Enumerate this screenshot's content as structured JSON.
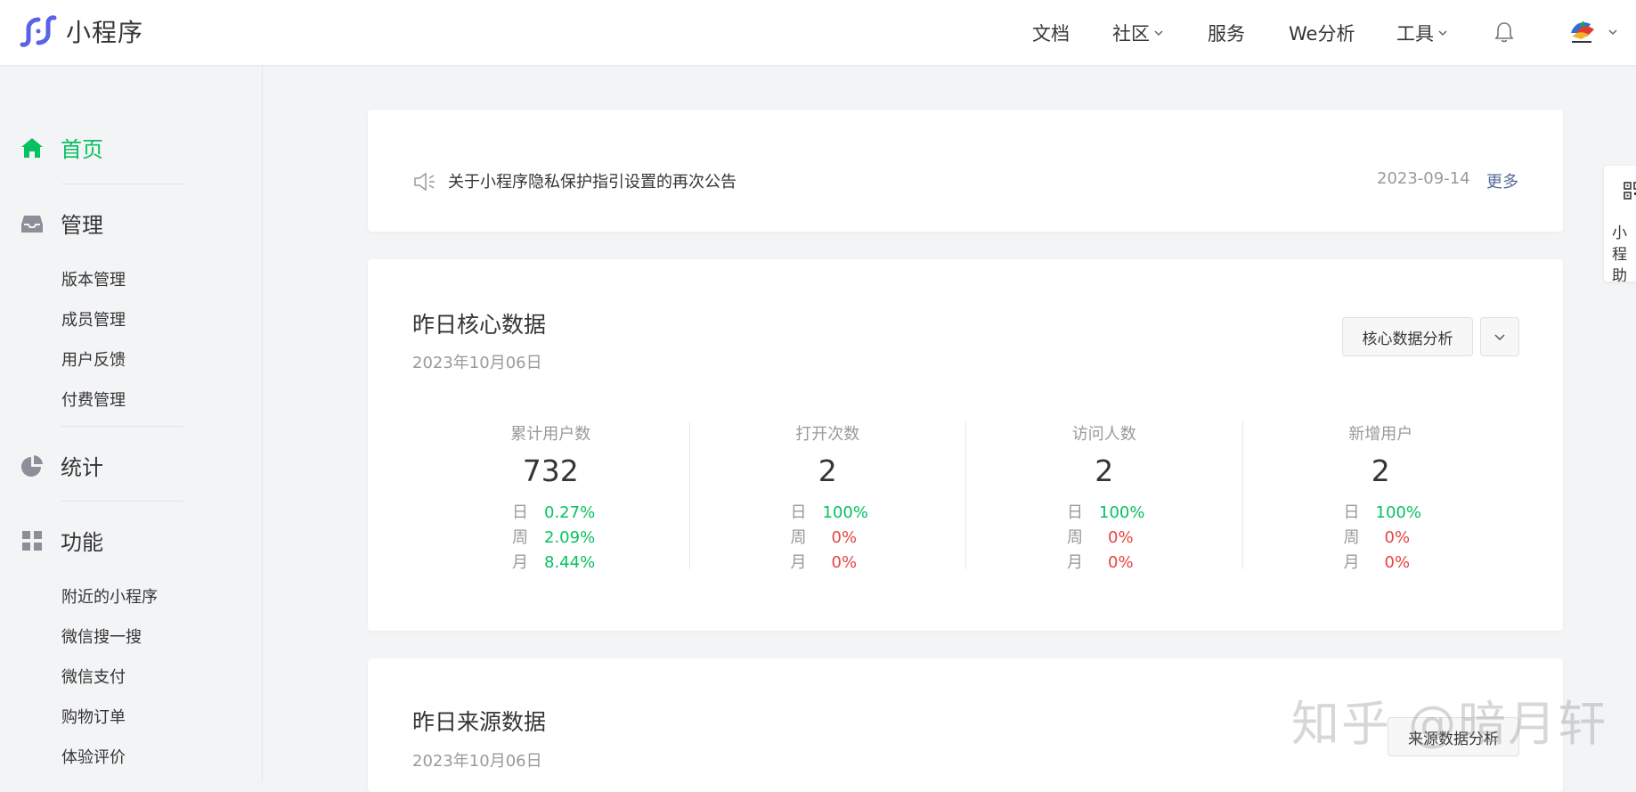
{
  "app": {
    "name": "小程序"
  },
  "topnav": {
    "docs": "文档",
    "community": "社区",
    "services": "服务",
    "we_analysis": "We分析",
    "tools": "工具"
  },
  "sidebar": {
    "home": "首页",
    "manage": "管理",
    "manage_items": [
      "版本管理",
      "成员管理",
      "用户反馈",
      "付费管理"
    ],
    "stats": "统计",
    "features": "功能",
    "feature_items": [
      "附近的小程序",
      "微信搜一搜",
      "微信支付",
      "购物订单",
      "体验评价"
    ]
  },
  "notice": {
    "text": "关于小程序隐私保护指引设置的再次公告",
    "date": "2023-09-14",
    "more": "更多"
  },
  "core": {
    "title": "昨日核心数据",
    "date": "2023年10月06日",
    "analysis_button": "核心数据分析",
    "metrics": [
      {
        "label": "累计用户数",
        "value": "732",
        "rows": [
          {
            "k": "日",
            "v": "0.27%",
            "trend": "up"
          },
          {
            "k": "周",
            "v": "2.09%",
            "trend": "up"
          },
          {
            "k": "月",
            "v": "8.44%",
            "trend": "up"
          }
        ]
      },
      {
        "label": "打开次数",
        "value": "2",
        "rows": [
          {
            "k": "日",
            "v": "100%",
            "trend": "up"
          },
          {
            "k": "周",
            "v": "0%",
            "trend": "flat"
          },
          {
            "k": "月",
            "v": "0%",
            "trend": "flat"
          }
        ]
      },
      {
        "label": "访问人数",
        "value": "2",
        "rows": [
          {
            "k": "日",
            "v": "100%",
            "trend": "up"
          },
          {
            "k": "周",
            "v": "0%",
            "trend": "flat"
          },
          {
            "k": "月",
            "v": "0%",
            "trend": "flat"
          }
        ]
      },
      {
        "label": "新增用户",
        "value": "2",
        "rows": [
          {
            "k": "日",
            "v": "100%",
            "trend": "up"
          },
          {
            "k": "周",
            "v": "0%",
            "trend": "flat"
          },
          {
            "k": "月",
            "v": "0%",
            "trend": "flat"
          }
        ]
      }
    ]
  },
  "source": {
    "title": "昨日来源数据",
    "date": "2023年10月06日",
    "analysis_button": "来源数据分析"
  },
  "float_widget": {
    "text": "小程助"
  },
  "watermark": "知乎 @暗月轩",
  "colors": {
    "brand_green": "#07c160",
    "link_blue": "#576b95",
    "decline_red": "#e64340",
    "logo_purple": "#5a63e8"
  },
  "icons": {
    "logo": "mini-program-logo-icon",
    "notice": "speaker-icon",
    "home": "home-icon",
    "manage": "inbox-icon",
    "stats": "pie-chart-icon",
    "features": "grid-icon",
    "bell": "bell-icon",
    "caret": "chevron-down-icon",
    "qr": "qr-code-icon"
  }
}
